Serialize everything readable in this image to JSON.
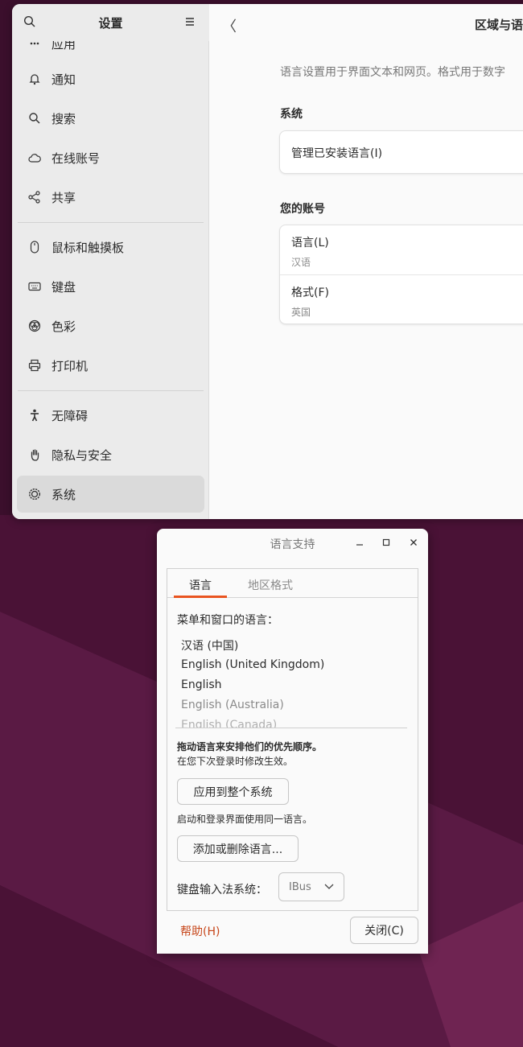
{
  "settings": {
    "sidebar": {
      "title": "设置",
      "items": [
        {
          "label": "应用",
          "icon": "apps-icon"
        },
        {
          "label": "通知",
          "icon": "bell-icon"
        },
        {
          "label": "搜索",
          "icon": "search-icon"
        },
        {
          "label": "在线账号",
          "icon": "cloud-icon"
        },
        {
          "label": "共享",
          "icon": "share-icon"
        },
        {
          "label": "鼠标和触摸板",
          "icon": "mouse-icon"
        },
        {
          "label": "键盘",
          "icon": "keyboard-icon"
        },
        {
          "label": "色彩",
          "icon": "color-icon"
        },
        {
          "label": "打印机",
          "icon": "printer-icon"
        },
        {
          "label": "无障碍",
          "icon": "accessibility-icon"
        },
        {
          "label": "隐私与安全",
          "icon": "hand-icon"
        },
        {
          "label": "系统",
          "icon": "system-icon"
        }
      ],
      "active_item": "系统"
    },
    "main": {
      "title": "区域与语",
      "description": "语言设置用于界面文本和网页。格式用于数字",
      "system_section": "系统",
      "manage_languages": "管理已安装语言(I)",
      "account_section": "您的账号",
      "language_label": "语言(L)",
      "language_value": "汉语",
      "format_label": "格式(F)",
      "format_value": "英国"
    }
  },
  "dialog": {
    "title": "语言支持",
    "tabs": [
      "语言",
      "地区格式"
    ],
    "active_tab": "语言",
    "menu_language_label": "菜单和窗口的语言：",
    "languages": [
      "汉语 (中国)",
      "English (United Kingdom)",
      "English",
      "English (Australia)",
      "English (Canada)"
    ],
    "drag_hint": "拖动语言来安排他们的优先顺序。",
    "next_login_hint": "在您下次登录时修改生效。",
    "apply_button": "应用到整个系统",
    "login_screen_hint": "启动和登录界面使用同一语言。",
    "add_remove_button": "添加或删除语言...",
    "input_method_label": "键盘输入法系统：",
    "input_method_value": "IBus",
    "help_button": "帮助(H)",
    "close_button": "关闭(C)"
  },
  "colors": {
    "accent": "#e95420",
    "wallpaper": "#3a0d2a"
  }
}
